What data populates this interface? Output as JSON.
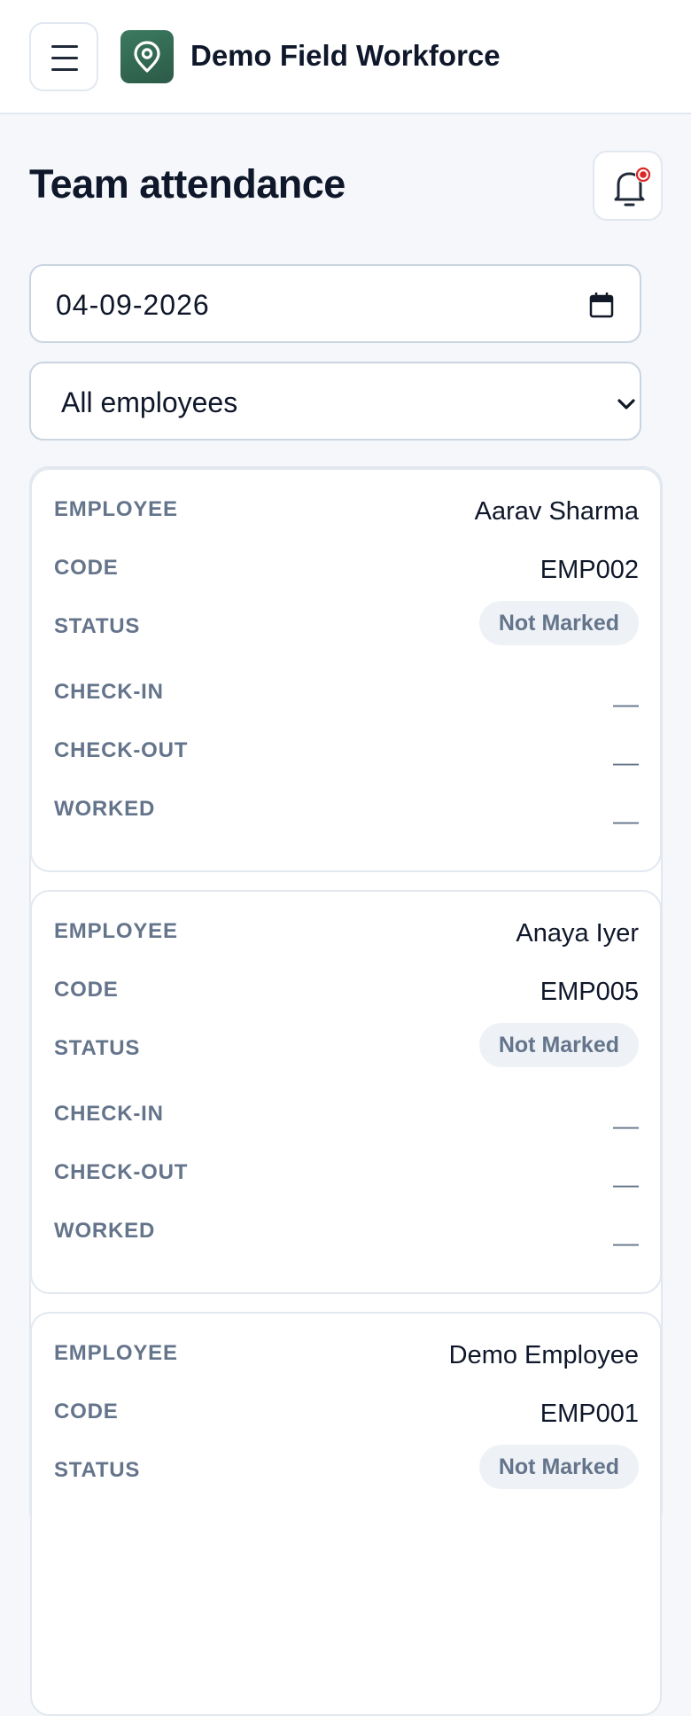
{
  "header": {
    "app_title": "Demo Field Workforce",
    "menu_icon": "hamburger-menu-icon",
    "logo_icon": "location-pin-icon",
    "brand_color": "#2f6650"
  },
  "page": {
    "title": "Team attendance",
    "notification_icon": "bell-icon",
    "notification_dot_color": "#dc2626"
  },
  "filters": {
    "date_value": "04-09-2026",
    "employee_select": "All employees"
  },
  "labels": {
    "employee": "EMPLOYEE",
    "code": "CODE",
    "status": "STATUS",
    "check_in": "CHECK-IN",
    "check_out": "CHECK-OUT",
    "worked": "WORKED"
  },
  "records": [
    {
      "employee": "Aarav Sharma",
      "code": "EMP002",
      "status": "Not Marked",
      "check_in": "—",
      "check_out": "—",
      "worked": "—"
    },
    {
      "employee": "Anaya Iyer",
      "code": "EMP005",
      "status": "Not Marked",
      "check_in": "—",
      "check_out": "—",
      "worked": "—"
    },
    {
      "employee": "Demo Employee",
      "code": "EMP001",
      "status": "Not Marked"
    }
  ]
}
